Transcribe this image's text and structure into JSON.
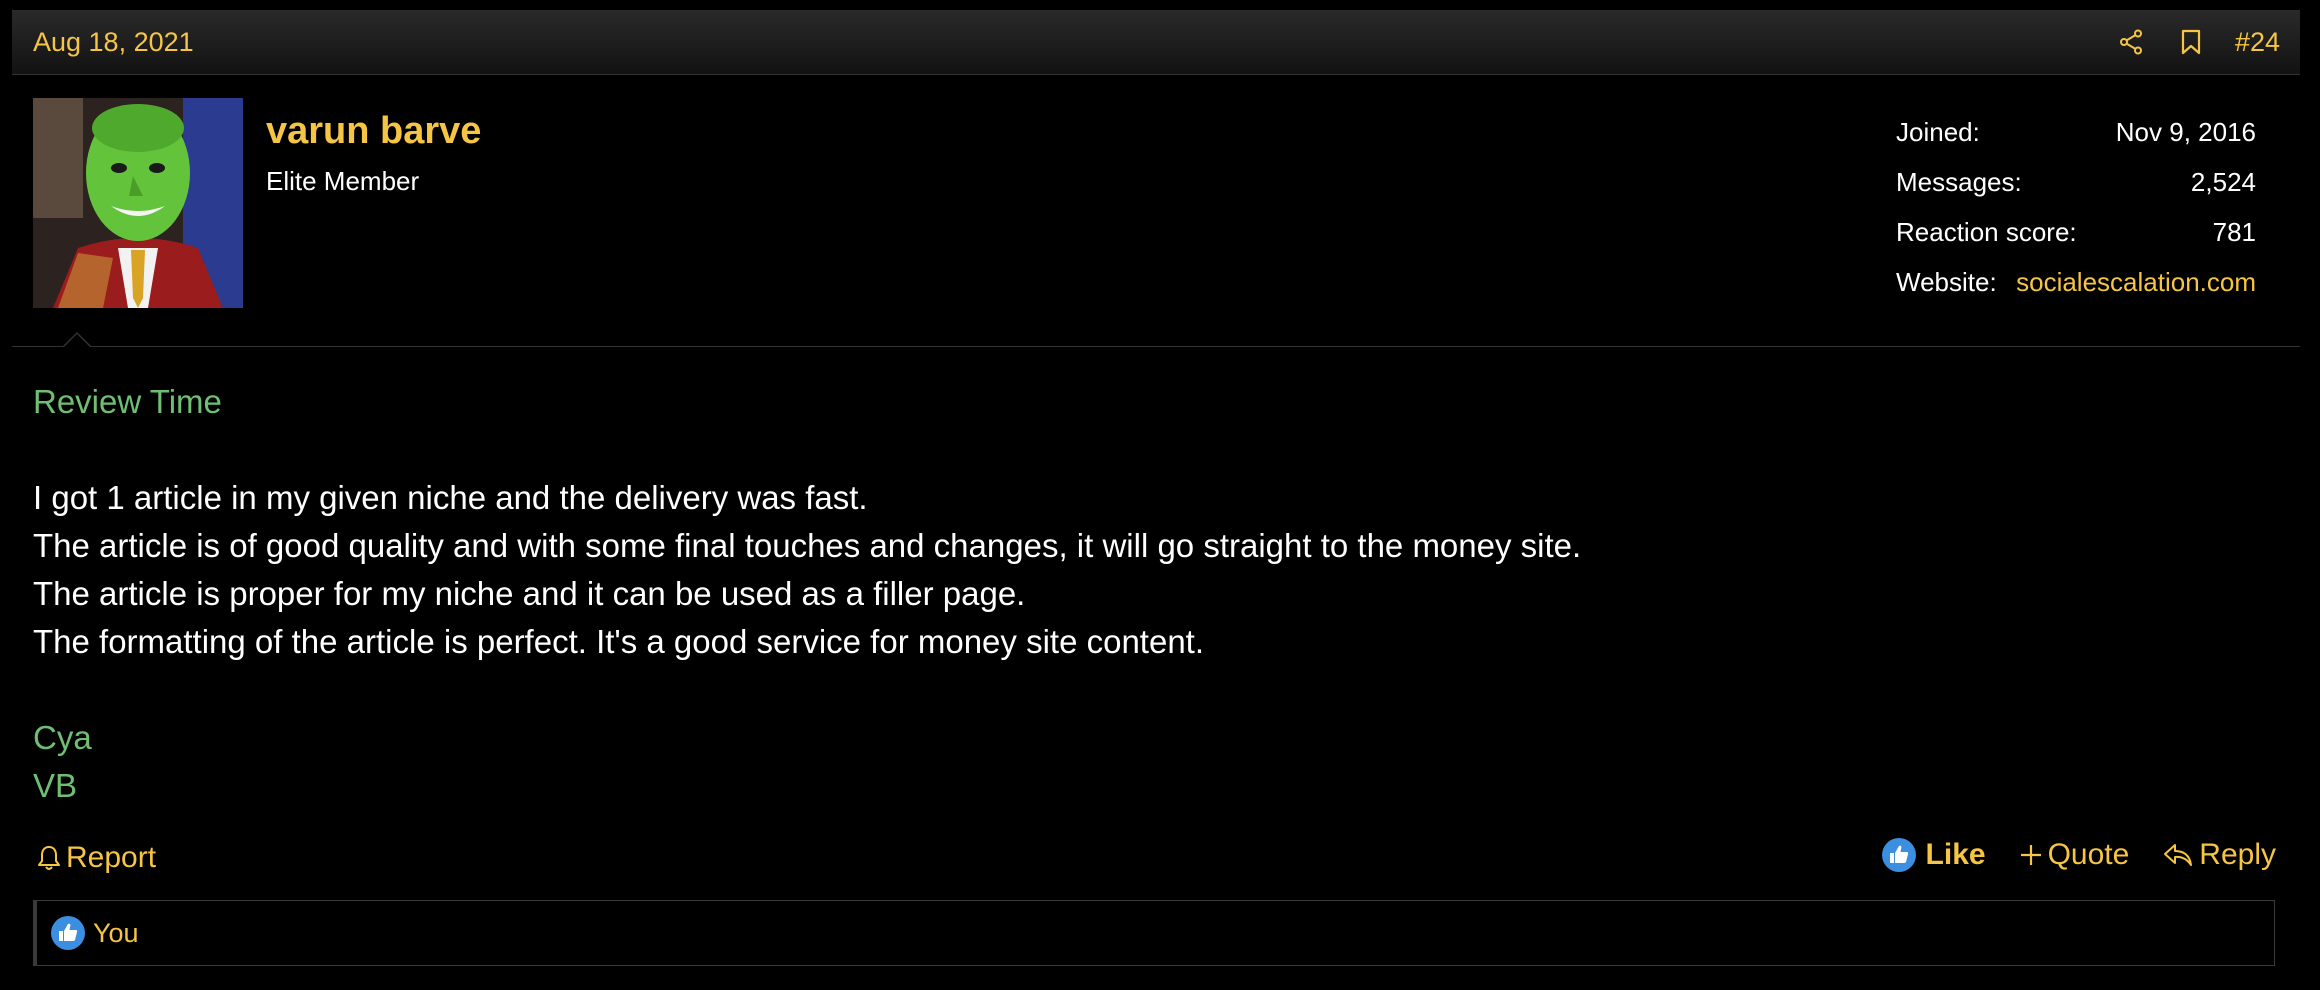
{
  "post": {
    "date": "Aug 18, 2021",
    "number": "#24",
    "header_icons": [
      "share-icon",
      "bookmark-icon"
    ]
  },
  "user": {
    "name": "varun barve",
    "title": "Elite Member",
    "stats": [
      {
        "label": "Joined:",
        "value": "Nov 9, 2016"
      },
      {
        "label": "Messages:",
        "value": "2,524"
      },
      {
        "label": "Reaction score:",
        "value": "781"
      },
      {
        "label": "Website:",
        "value": "socialescalation.com"
      }
    ]
  },
  "message": {
    "heading": "Review Time",
    "lines": [
      "I got 1 article in my given niche and the delivery was fast.",
      "The article is of good quality and with some final touches and changes, it will go straight to the money site.",
      "The article is proper for my niche and it can be used as a filler page.",
      "The formatting of the article is perfect. It's a good service for money site content."
    ],
    "signoff": [
      "Cya",
      "VB"
    ]
  },
  "footer": {
    "report_label": "Report",
    "like_label": "Like",
    "quote_label": "Quote",
    "reply_label": "Reply"
  },
  "reactions": {
    "who": "You"
  },
  "colors": {
    "accent": "#f6c544",
    "green_text": "#6fbf73",
    "like_blue": "#3b8ee0"
  }
}
